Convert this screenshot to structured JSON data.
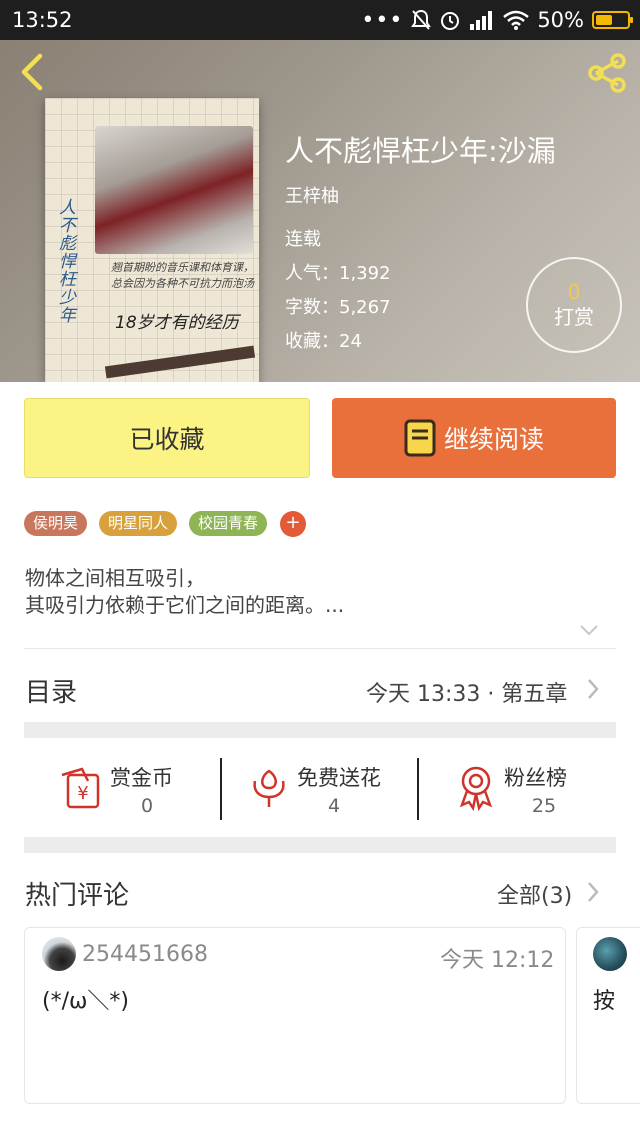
{
  "status_bar": {
    "time": "13:52",
    "icons": [
      "dots-icon",
      "mute-bell-icon",
      "alarm-icon",
      "signal-icon",
      "wifi-icon"
    ],
    "battery": "50%"
  },
  "book": {
    "title": "人不彪悍枉少年:沙漏",
    "author": "王梓柚",
    "status": "连载",
    "popularity": "人气：1,392",
    "word_count": "字数：5,267",
    "collected": "收藏：24",
    "cover": {
      "title_vertical": "人不彪悍枉少年",
      "handwriting_1": "翘首期盼的音乐课和体育课，总会因为各种不可抗力而泡汤",
      "handwriting_2": "18岁才有的经历"
    }
  },
  "reward": {
    "count": "0",
    "label": "打赏"
  },
  "actions": {
    "favorite_label": "已收藏",
    "read_label": "继续阅读",
    "read_icon": "book-icon"
  },
  "tags": [
    {
      "label": "侯明昊",
      "color": "#c8775d"
    },
    {
      "label": "明星同人",
      "color": "#d9a13c"
    },
    {
      "label": "校园青春",
      "color": "#8fb456"
    }
  ],
  "tag_add_label": "+",
  "intro": {
    "line1": "物体之间相互吸引，",
    "line2": "其吸引力依赖于它们之间的距离。..."
  },
  "toc": {
    "title": "目录",
    "latest": "今天 13:33 · 第五章"
  },
  "stats": [
    {
      "label": "赏金币",
      "value": "0",
      "icon": "red-envelope-yen-icon"
    },
    {
      "label": "免费送花",
      "value": "4",
      "icon": "flower-icon"
    },
    {
      "label": "粉丝榜",
      "value": "25",
      "icon": "ribbon-medal-icon"
    }
  ],
  "comments": {
    "title": "热门评论",
    "all_label": "全部(3)",
    "items": [
      {
        "user": "254451668",
        "time": "今天 12:12",
        "text": "(*/ω＼*)"
      },
      {
        "text": "按"
      }
    ]
  },
  "colors": {
    "accent_orange": "#e96f3b",
    "fav_yellow": "#fbf383",
    "icon_red": "#d0332a",
    "reward_gold": "#f2c94c"
  }
}
